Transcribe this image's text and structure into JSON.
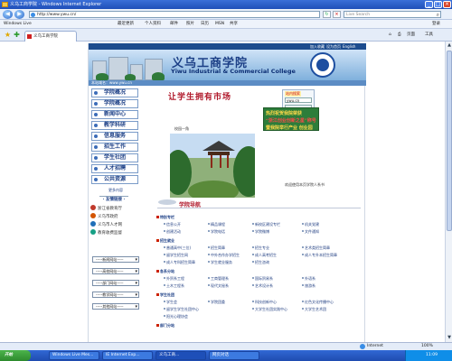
{
  "window": {
    "title": "义乌工商学院 - Windows Internet Explorer",
    "controls": [
      "_",
      "□",
      "×"
    ]
  },
  "address": {
    "url": "http://www.ywu.cn/",
    "search_placeholder": "Live Search"
  },
  "toolbar": {
    "brand": "Windows Live",
    "items": [
      "最近更新",
      "个人资料",
      "邮件",
      "照片",
      "日历",
      "MSN",
      "共享"
    ],
    "login": "登录"
  },
  "tabs": {
    "active_label": "义乌工商学院",
    "tools": [
      "页面",
      "工具"
    ]
  },
  "site": {
    "top_links": [
      "加入收藏",
      "设为首页",
      "English"
    ],
    "name_cn": "义乌工商学院",
    "name_en": "Yiwu Industrial & Commercial College",
    "url_strip": "本站域名：www.ywu.cn",
    "slogan": "让学生拥有市场",
    "search": {
      "label": "站内搜索",
      "value": "ywu.cn"
    },
    "ad_lines": [
      "热烈祝贺我院荣获",
      "“浙江创业创新之星”称号",
      "暨我院举行产业 创业园"
    ],
    "photo_caption": "校园一角",
    "welcome": "欢迎使用本页学院人系书",
    "section_title": "学院导航"
  },
  "left_menu": [
    "学院概况",
    "学院概况",
    "新闻中心",
    "教学科研",
    "信息服务",
    "招生工作",
    "学生社团",
    "人才招聘",
    "公共资源"
  ],
  "left_menu_note": "更多内容",
  "links_header": "· 友情链接 ·",
  "links": [
    {
      "label": "浙江省教育厅",
      "color": "#c0392b"
    },
    {
      "label": "义乌市政府",
      "color": "#d35400"
    },
    {
      "label": "义乌市人才网",
      "color": "#1f6fb8"
    },
    {
      "label": "教育收费监督",
      "color": "#16a085"
    }
  ],
  "selects": [
    "-----新闻网站-----",
    "-----高校网站-----",
    "-----部门网站-----",
    "-----教学网站-----",
    "-----其他网站-----"
  ],
  "categories": [
    {
      "title": "特别专栏",
      "items": [
        "信息公开",
        "精品课程",
        "新校区建设专栏",
        "机关党建",
        "创建活动",
        "学院电话",
        "学院微博",
        "文件通知"
      ]
    },
    {
      "title": "招生就业",
      "items": [
        "普通高中(三位)",
        "招生简章",
        "招生专业",
        "艺术类招生简章",
        "留学生招生网",
        "中外合作办学招生",
        "成人高考招生",
        "成人专升本招生简章",
        "成人专科招生简章",
        "学生就业服务",
        "招生咨询"
      ]
    },
    {
      "title": "各系分站",
      "items": [
        "外贸系工程",
        "工商管理系",
        "国际贸易系",
        "外语系",
        "土木工程系",
        "现代文秘系",
        "艺术设计系",
        "旅游系"
      ]
    },
    {
      "title": "学生社团",
      "items": [
        "学生会",
        "学院团委",
        "科技创新中心",
        "红色文化传播中心",
        "留学生学生社团中心",
        "大学生社团实践中心",
        "阳光心理协会",
        "大学生艺术团"
      ]
    },
    {
      "title": "部门分站",
      "items": []
    }
  ],
  "status": {
    "zone": "Internet",
    "zoom": "100%"
  },
  "taskbar": {
    "start": "开始",
    "tasks": [
      "Windows Live Mes...",
      "IE Internet Exp...",
      "义乌工商...",
      "网页对话"
    ],
    "clock": "11:09"
  }
}
